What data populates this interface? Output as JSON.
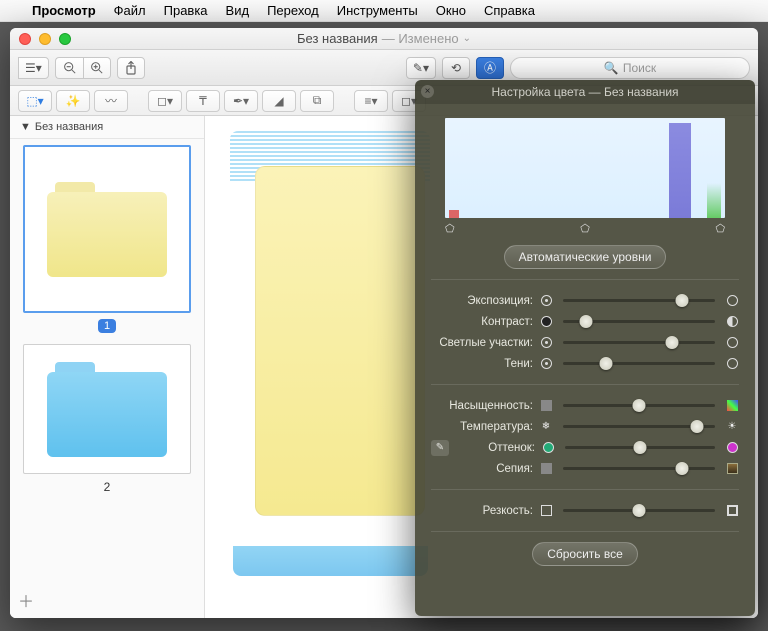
{
  "menubar": {
    "app": "Просмотр",
    "items": [
      "Файл",
      "Правка",
      "Вид",
      "Переход",
      "Инструменты",
      "Окно",
      "Справка"
    ]
  },
  "window": {
    "title": "Без названия",
    "modified": "— Изменено",
    "search_placeholder": "Поиск"
  },
  "sidebar": {
    "header": "Без названия",
    "thumbs": [
      {
        "label": "1",
        "selected": true,
        "color": "yellow"
      },
      {
        "label": "2",
        "selected": false,
        "color": "blue"
      }
    ]
  },
  "panel": {
    "title": "Настройка цвета — Без названия",
    "auto_levels": "Автоматические уровни",
    "reset_all": "Сбросить все",
    "sliders": {
      "exposure": {
        "label": "Экспозиция:",
        "value": 78
      },
      "contrast": {
        "label": "Контраст:",
        "value": 15
      },
      "highlights": {
        "label": "Светлые участки:",
        "value": 72
      },
      "shadows": {
        "label": "Тени:",
        "value": 28
      },
      "saturation": {
        "label": "Насыщенность:",
        "value": 50
      },
      "temperature": {
        "label": "Температура:",
        "value": 88
      },
      "tint": {
        "label": "Оттенок:",
        "value": 50
      },
      "sepia": {
        "label": "Сепия:",
        "value": 78
      },
      "sharpness": {
        "label": "Резкость:",
        "value": 50
      }
    }
  }
}
